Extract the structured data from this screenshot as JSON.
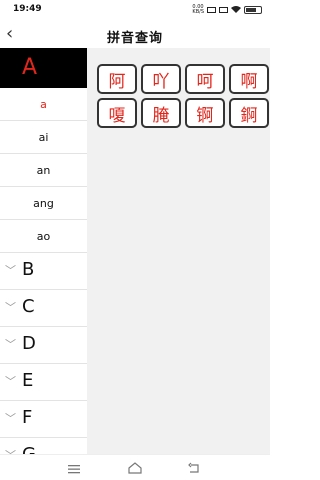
{
  "status": {
    "time": "19:49",
    "net_speed": "0.00\nKB/S"
  },
  "header": {
    "title": "拼音查询",
    "back_icon": "‹"
  },
  "sidebar": {
    "active_letter": "A",
    "syllables": [
      "a",
      "ai",
      "an",
      "ang",
      "ao"
    ],
    "selected_syllable": "a",
    "letters": [
      "B",
      "C",
      "D",
      "E",
      "F",
      "G"
    ]
  },
  "characters": [
    "阿",
    "吖",
    "呵",
    "啊",
    "嗄",
    "腌",
    "锕",
    "錒"
  ],
  "colors": {
    "accent": "#e1261c",
    "active_bg": "#000000",
    "content_bg": "#f1f1f1"
  }
}
